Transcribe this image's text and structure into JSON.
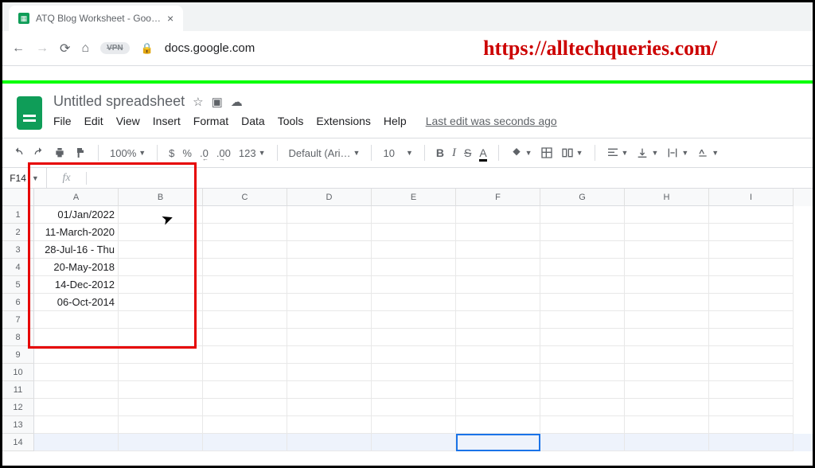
{
  "browser": {
    "tab_title": "ATQ Blog Worksheet - Goo…",
    "url_display": "docs.google.com",
    "vpn_label": "VPN",
    "watermark": "https://alltechqueries.com/"
  },
  "doc": {
    "title": "Untitled spreadsheet",
    "menus": [
      "File",
      "Edit",
      "View",
      "Insert",
      "Format",
      "Data",
      "Tools",
      "Extensions",
      "Help"
    ],
    "last_edit": "Last edit was seconds ago"
  },
  "toolbar": {
    "zoom": "100%",
    "currency": "$",
    "percent": "%",
    "dec_dec": ".0",
    "dec_inc": ".00",
    "num_fmt": "123",
    "font": "Default (Ari…",
    "font_size": "10",
    "bold": "B",
    "italic": "I",
    "strike": "S",
    "text_color": "A"
  },
  "namebox": {
    "ref": "F14",
    "fx": "fx"
  },
  "grid": {
    "columns": [
      "A",
      "B",
      "C",
      "D",
      "E",
      "F",
      "G",
      "H",
      "I"
    ],
    "rows": [
      "1",
      "2",
      "3",
      "4",
      "5",
      "6",
      "7",
      "8",
      "9",
      "10",
      "11",
      "12",
      "13",
      "14"
    ],
    "cells": {
      "A1": "01/Jan/2022",
      "A2": "11-March-2020",
      "A3": "28-Jul-16 - Thu",
      "A4": "20-May-2018",
      "A5": "14-Dec-2012",
      "A6": "06-Oct-2014"
    },
    "selected_cell": "F14"
  }
}
